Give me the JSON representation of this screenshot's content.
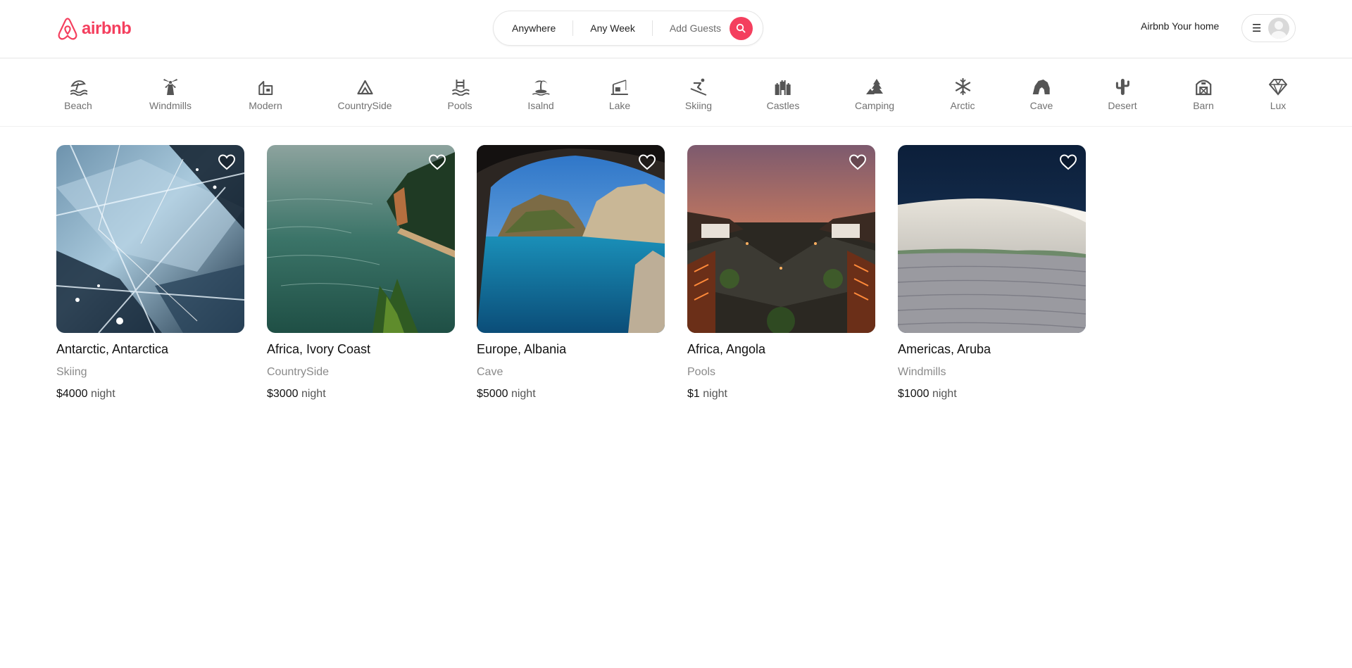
{
  "brand": {
    "name": "airbnb",
    "color": "#f43f5e"
  },
  "search": {
    "where": "Anywhere",
    "when": "Any Week",
    "guests": "Add Guests",
    "button_icon": "search-icon"
  },
  "nav": {
    "host_link": "Airbnb Your home",
    "menu_icon": "hamburger-icon",
    "avatar": "user-avatar"
  },
  "categories": [
    {
      "label": "Beach",
      "icon": "beach-icon"
    },
    {
      "label": "Windmills",
      "icon": "windmill-icon"
    },
    {
      "label": "Modern",
      "icon": "modern-house-icon"
    },
    {
      "label": "CountrySide",
      "icon": "mountain-icon"
    },
    {
      "label": "Pools",
      "icon": "pool-icon"
    },
    {
      "label": "Isalnd",
      "icon": "island-icon"
    },
    {
      "label": "Lake",
      "icon": "lake-icon"
    },
    {
      "label": "Skiing",
      "icon": "skiing-icon"
    },
    {
      "label": "Castles",
      "icon": "castle-icon"
    },
    {
      "label": "Camping",
      "icon": "camping-icon"
    },
    {
      "label": "Arctic",
      "icon": "snowflake-icon"
    },
    {
      "label": "Cave",
      "icon": "cave-icon"
    },
    {
      "label": "Desert",
      "icon": "cactus-icon"
    },
    {
      "label": "Barn",
      "icon": "barn-icon"
    },
    {
      "label": "Lux",
      "icon": "diamond-icon"
    }
  ],
  "listings": [
    {
      "title": "Antarctic, Antarctica",
      "category": "Skiing",
      "price": "$4000",
      "unit": "night"
    },
    {
      "title": "Africa, Ivory Coast",
      "category": "CountrySide",
      "price": "$3000",
      "unit": "night"
    },
    {
      "title": "Europe, Albania",
      "category": "Cave",
      "price": "$5000",
      "unit": "night"
    },
    {
      "title": "Africa, Angola",
      "category": "Pools",
      "price": "$1",
      "unit": "night"
    },
    {
      "title": "Americas, Aruba",
      "category": "Windmills",
      "price": "$1000",
      "unit": "night"
    }
  ]
}
